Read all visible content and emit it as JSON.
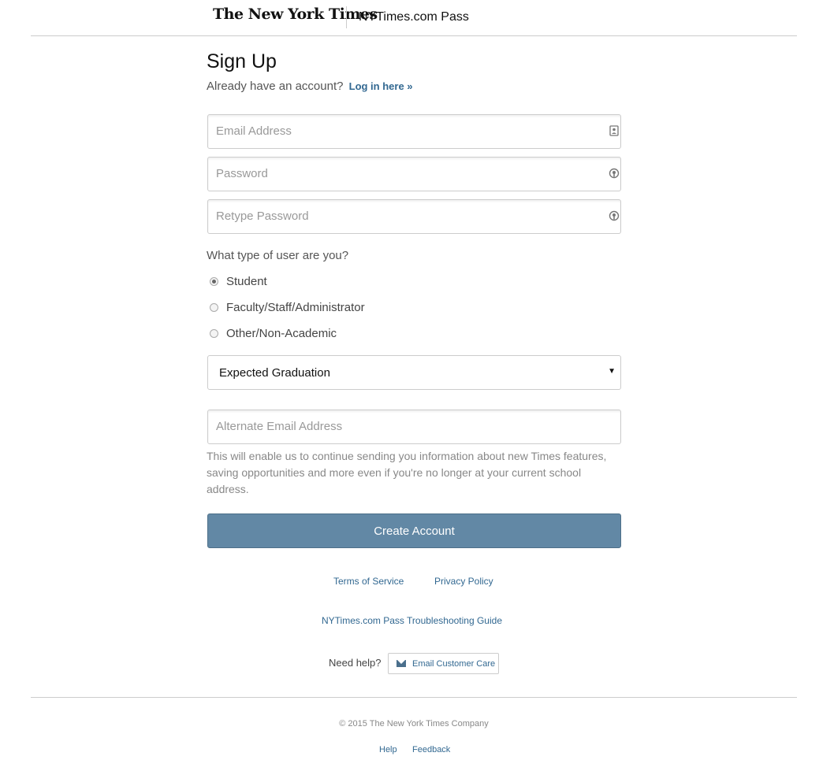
{
  "header": {
    "logo_text": "The New York Times",
    "product_title": "NYTimes.com Pass"
  },
  "form": {
    "title": "Sign Up",
    "account_prompt": "Already have an account?",
    "login_link": "Log in here »",
    "email": {
      "placeholder": "Email Address",
      "value": "",
      "icon": "contact-card-icon"
    },
    "password": {
      "placeholder": "Password",
      "value": "",
      "icon": "key-icon"
    },
    "retype_password": {
      "placeholder": "Retype Password",
      "value": "",
      "icon": "key-icon"
    },
    "user_type_question": "What type of user are you?",
    "user_types": [
      {
        "label": "Student",
        "selected": true
      },
      {
        "label": "Faculty/Staff/Administrator",
        "selected": false
      },
      {
        "label": "Other/Non-Academic",
        "selected": false
      }
    ],
    "graduation_select": {
      "selected": "Expected Graduation"
    },
    "alternate_email": {
      "placeholder": "Alternate Email Address",
      "value": ""
    },
    "alternate_email_help": "This will enable us to continue sending you information about new Times features, saving opportunities and more even if you're no longer at your current school address.",
    "submit_label": "Create Account"
  },
  "links": {
    "terms": "Terms of Service",
    "privacy": "Privacy Policy",
    "troubleshooting": "NYTimes.com Pass Troubleshooting Guide",
    "need_help": "Need help?",
    "email_care": "Email Customer Care"
  },
  "footer": {
    "copyright": "© 2015 The New York Times Company",
    "help": "Help",
    "feedback": "Feedback"
  },
  "colors": {
    "accent": "#326891",
    "button": "#6288a5"
  }
}
